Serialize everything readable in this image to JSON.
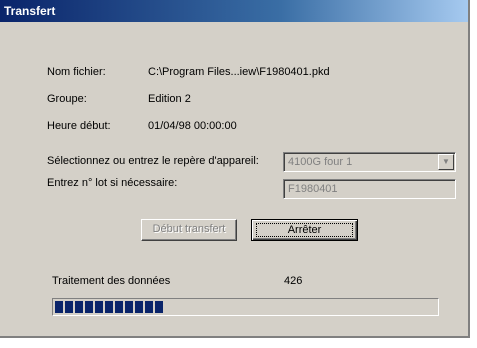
{
  "window": {
    "title": "Transfert"
  },
  "file_info": {
    "filename_label": "Nom fichier:",
    "filename_value": "C:\\Program Files...iew\\F1980401.pkd",
    "group_label": "Groupe:",
    "group_value": "Edition 2",
    "start_time_label": "Heure début:",
    "start_time_value": "01/04/98 00:00:00"
  },
  "device": {
    "select_label": "Sélectionnez ou entrez le repère d'appareil:",
    "select_value": "4100G four 1",
    "lot_label": "Entrez n° lot si nécessaire:",
    "lot_value": "F1980401"
  },
  "buttons": {
    "start_label": "Début transfert",
    "stop_label": "Arrêter"
  },
  "progress": {
    "label": "Traitement des données",
    "count": "426",
    "fraction": 0.3,
    "color": "#0a246a"
  }
}
